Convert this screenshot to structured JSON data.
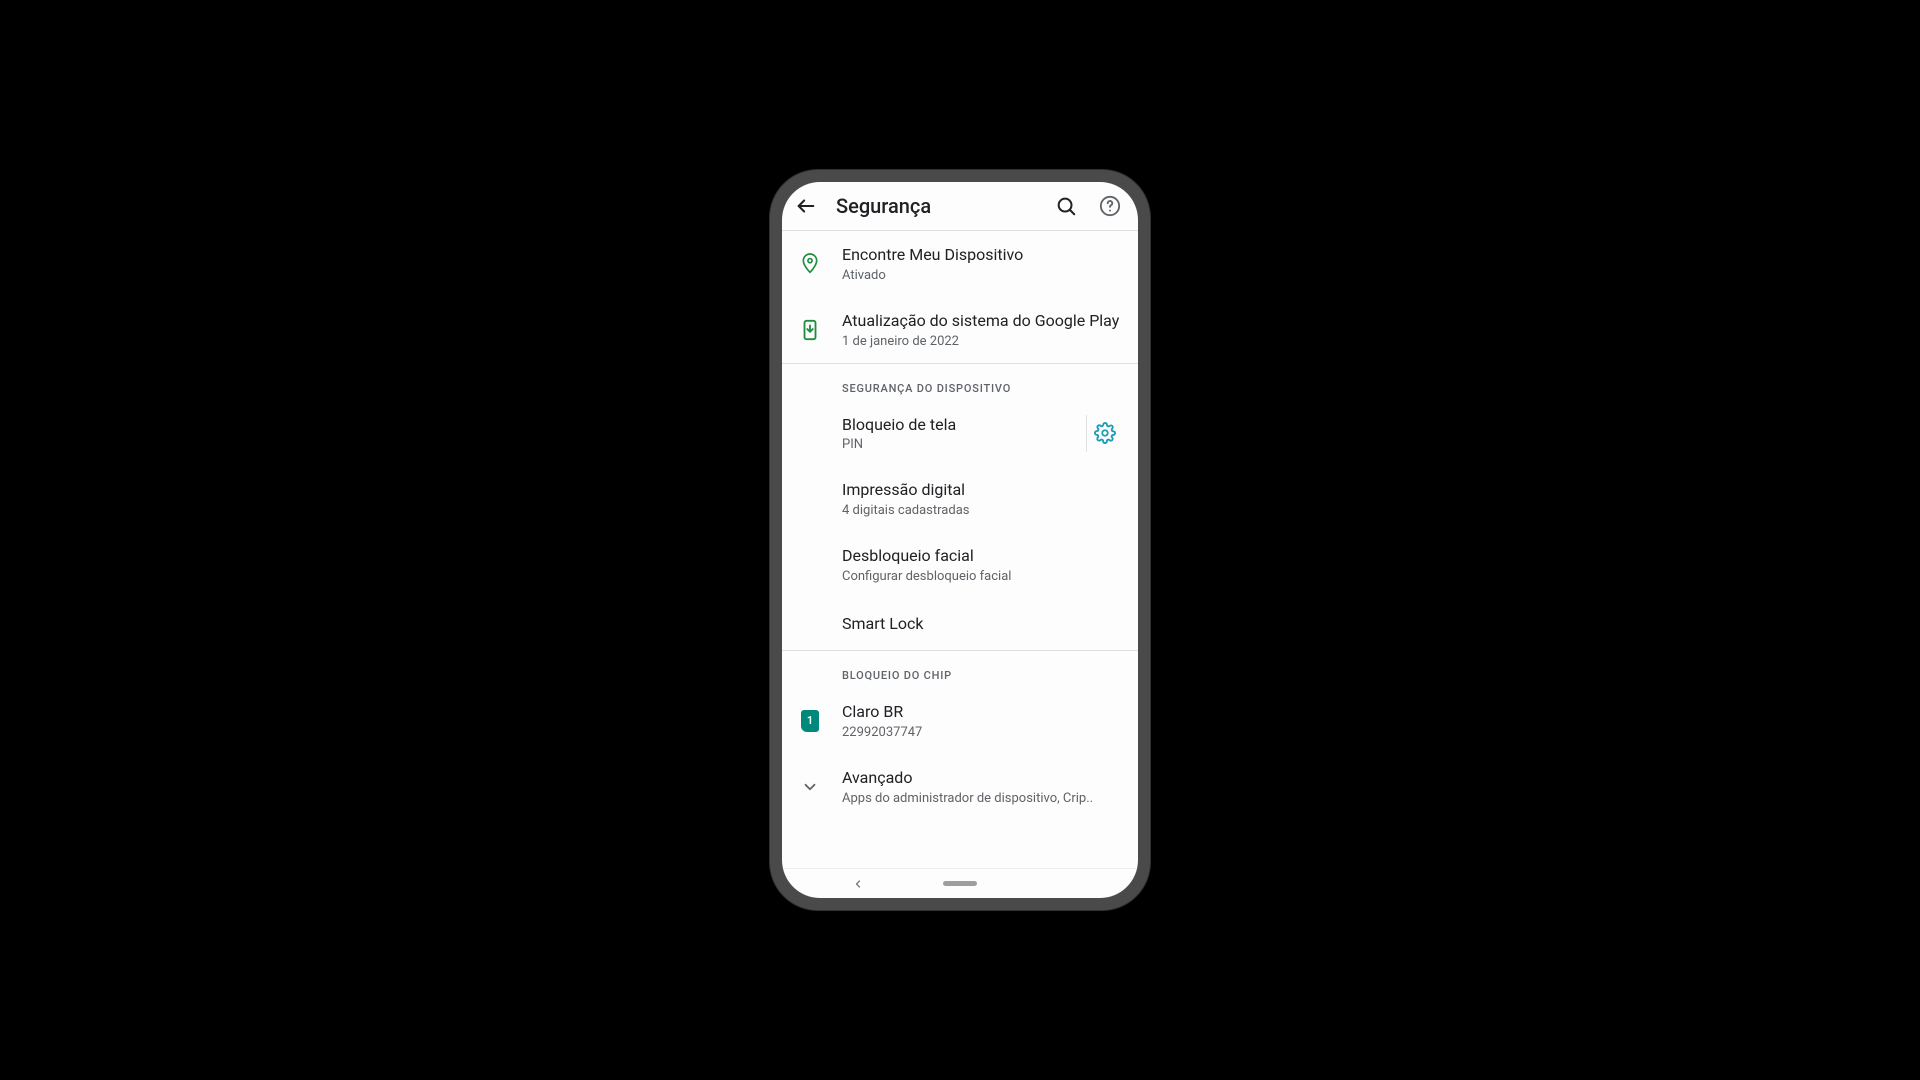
{
  "appbar": {
    "title": "Segurança"
  },
  "items": {
    "find_device": {
      "title": "Encontre Meu Dispositivo",
      "subtitle": "Ativado"
    },
    "play_update": {
      "title": "Atualização do sistema do Google Play",
      "subtitle": "1 de janeiro de 2022"
    }
  },
  "section_device": {
    "header": "Segurança do dispositivo",
    "screen_lock": {
      "title": "Bloqueio de tela",
      "subtitle": "PIN"
    },
    "fingerprint": {
      "title": "Impressão digital",
      "subtitle": "4 digitais cadastradas"
    },
    "face_unlock": {
      "title": "Desbloqueio facial",
      "subtitle": "Configurar desbloqueio facial"
    },
    "smart_lock": {
      "title": "Smart Lock"
    }
  },
  "section_sim": {
    "header": "Bloqueio do chip",
    "sim1": {
      "badge": "1",
      "title": "Claro BR",
      "subtitle": "22992037747"
    }
  },
  "advanced": {
    "title": "Avançado",
    "subtitle": "Apps do administrador de dispositivo, Crip.."
  }
}
